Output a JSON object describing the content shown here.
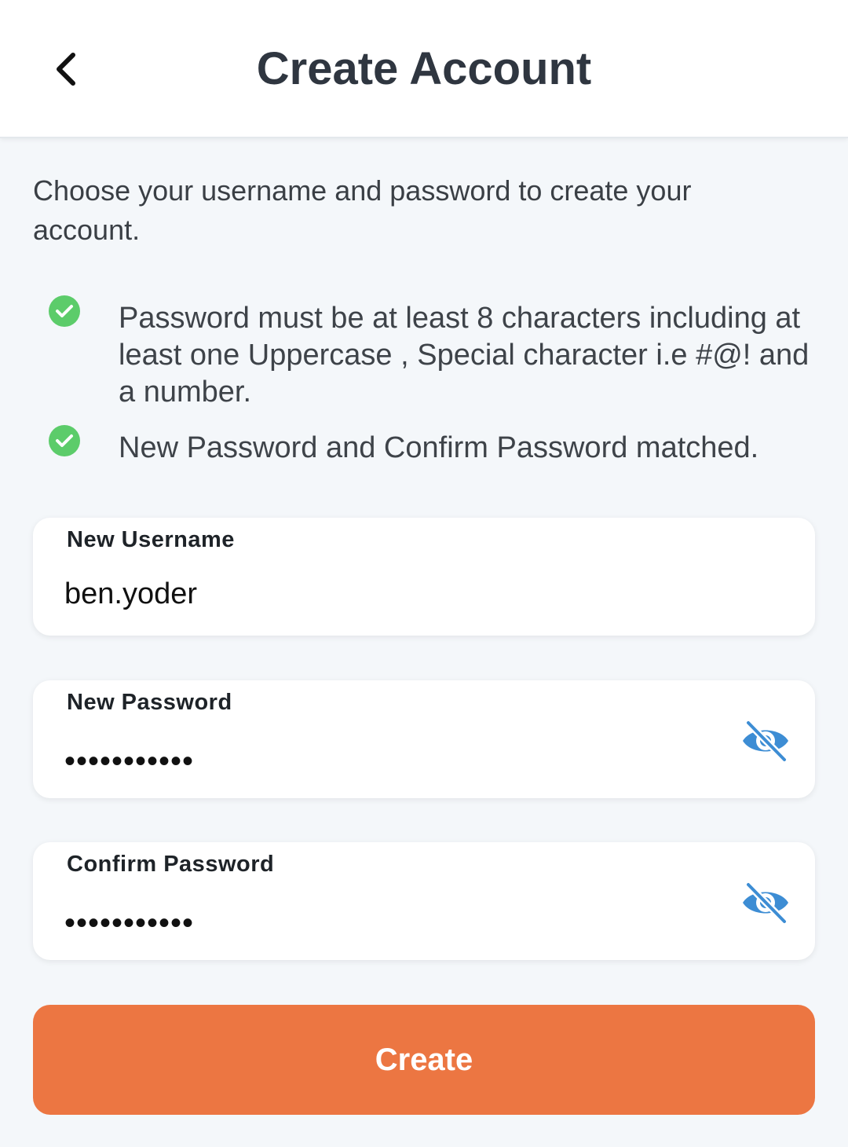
{
  "header": {
    "title": "Create Account",
    "back_icon": "chevron-left-icon"
  },
  "intro_text": "Choose your username and password to create your account.",
  "rules": [
    {
      "text": "Password must be at least 8 characters including at least one Uppercase , Special character i.e #@! and a number.",
      "status": "met",
      "icon": "check-circle-icon"
    },
    {
      "text": "New Password and Confirm Password matched.",
      "status": "met",
      "icon": "check-circle-icon"
    }
  ],
  "fields": {
    "username": {
      "label": "New Username",
      "value": "ben.yoder"
    },
    "password": {
      "label": "New Password",
      "value": "•••••••••••",
      "icon": "eye-off-icon"
    },
    "confirm": {
      "label": "Confirm Password",
      "value": "•••••••••••",
      "icon": "eye-off-icon"
    }
  },
  "create_button": {
    "label": "Create"
  },
  "colors": {
    "accent": "#ec7642",
    "check": "#5ccc6a",
    "eye_icon": "#3d8dd4",
    "title": "#2f3640"
  }
}
